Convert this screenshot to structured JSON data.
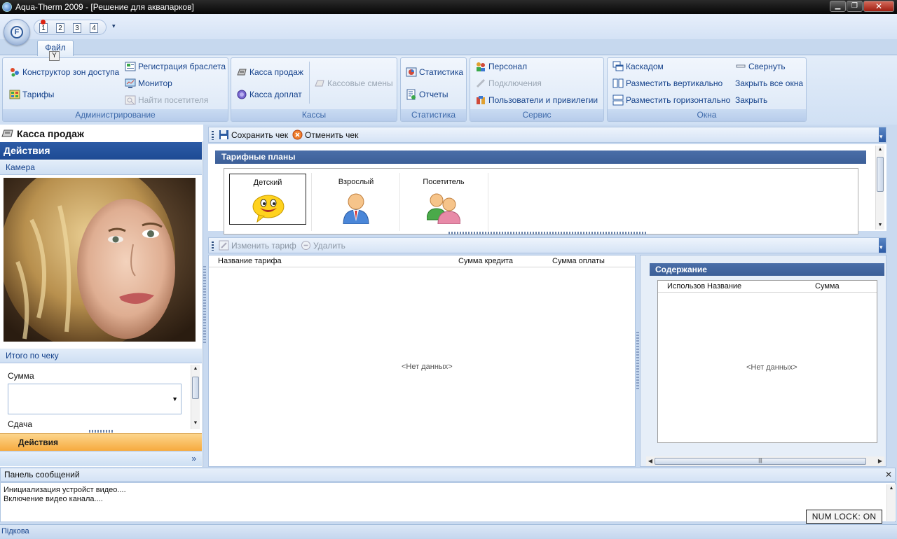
{
  "window": {
    "title": "Aqua-Therm 2009 - [Решение для аквапарков]",
    "min_label": "▁",
    "max_label": "❐",
    "close_label": "✕"
  },
  "qat": {
    "orb_letter": "F",
    "buttons": [
      "1",
      "2",
      "3",
      "4"
    ],
    "more_label": "▾"
  },
  "tabs": {
    "file": "Файл",
    "file_keytip": "Y"
  },
  "ribbon": {
    "groups": [
      {
        "label": "Администрирование",
        "items": [
          {
            "label": "Конструктор зон доступа",
            "enabled": true,
            "icon": "zones-icon"
          },
          {
            "label": "Тарифы",
            "enabled": true,
            "icon": "tariffs-icon"
          },
          {
            "label": "Регистрация браслета",
            "enabled": true,
            "icon": "bracelet-register-icon"
          },
          {
            "label": "Монитор",
            "enabled": true,
            "icon": "monitor-icon"
          },
          {
            "label": "Найти посетителя",
            "enabled": false,
            "icon": "find-visitor-icon"
          }
        ]
      },
      {
        "label": "Кассы",
        "items": [
          {
            "label": "Касса продаж",
            "enabled": true,
            "icon": "sales-register-icon"
          },
          {
            "label": "Касса доплат",
            "enabled": true,
            "icon": "surcharge-register-icon"
          },
          {
            "label": "Кассовые смены",
            "enabled": false,
            "icon": "cash-shifts-icon"
          }
        ]
      },
      {
        "label": "Статистика",
        "items": [
          {
            "label": "Статистика",
            "enabled": true,
            "icon": "statistics-icon"
          },
          {
            "label": "Отчеты",
            "enabled": true,
            "icon": "reports-icon"
          }
        ]
      },
      {
        "label": "Сервис",
        "items": [
          {
            "label": "Персонал",
            "enabled": true,
            "icon": "personnel-icon"
          },
          {
            "label": "Подключения",
            "enabled": false,
            "icon": "connections-icon"
          },
          {
            "label": "Пользователи и привилегии",
            "enabled": true,
            "icon": "users-privileges-icon"
          }
        ]
      },
      {
        "label": "Окна",
        "items": [
          {
            "label": "Каскадом",
            "enabled": true,
            "icon": "cascade-icon"
          },
          {
            "label": "Разместить вертикально",
            "enabled": true,
            "icon": "tile-vertical-icon"
          },
          {
            "label": "Разместить горизонтально",
            "enabled": true,
            "icon": "tile-horizontal-icon"
          },
          {
            "label": "Свернуть",
            "enabled": true,
            "icon": "minimize-icon"
          },
          {
            "label": "Закрыть все окна",
            "enabled": true,
            "icon": ""
          },
          {
            "label": "Закрыть",
            "enabled": true,
            "icon": ""
          }
        ]
      }
    ]
  },
  "left_pane": {
    "title": "Касса продаж",
    "actions_header": "Действия",
    "camera_label": "Камера",
    "totals_label": "Итого по чеку",
    "sum_label": "Сумма",
    "change_label": "Сдача",
    "actions_bar": "Действия",
    "expand_label": "»"
  },
  "check_toolbar": {
    "save": "Сохранить чек",
    "cancel": "Отменить чек"
  },
  "tariff_plans": {
    "header": "Тарифные планы",
    "cards": [
      {
        "name": "Детский",
        "icon": "smiley-icon",
        "selected": true
      },
      {
        "name": "Взрослый",
        "icon": "adult-user-icon",
        "selected": false
      },
      {
        "name": "Посетитель",
        "icon": "visitors-icon",
        "selected": false
      }
    ]
  },
  "tariff_toolbar": {
    "edit": "Изменить тариф",
    "delete": "Удалить"
  },
  "tariff_grid": {
    "columns": [
      "Название тарифа",
      "Сумма кредита",
      "Сумма оплаты"
    ],
    "empty": "<Нет данных>"
  },
  "content_panel": {
    "header": "Содержание",
    "columns": [
      "Использов",
      "Название",
      "Сумма"
    ],
    "empty": "<Нет данных>"
  },
  "messages": {
    "header": "Панель сообщений",
    "close_label": "✕",
    "lines": [
      "Инициализация устройст видео....",
      "Включение видео канала...."
    ]
  },
  "status": {
    "numlock": "NUM LOCK: ON",
    "text": "Підкова"
  }
}
